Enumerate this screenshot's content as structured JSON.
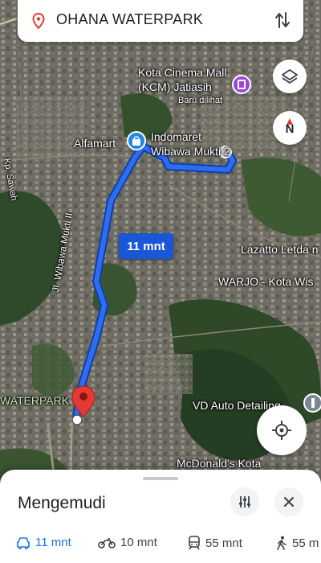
{
  "search": {
    "destination": "OHANA WATERPARK"
  },
  "map": {
    "labels": {
      "kcm_line1": "Kota Cinema Mall",
      "kcm_line2": "(KCM) Jatiasih",
      "kcm_sub": "Baru dilihat",
      "alfamart": "Alfamart",
      "indomaret_line1": "Indomaret",
      "indomaret_line2": "Wibawa Mukti 2",
      "lazatto": "Lazatto Letda n",
      "warjo": "WARJO - Kota Wis",
      "road": "Jl. Wibawa Mukti II",
      "waterpark": "WATERPARK",
      "vd_auto": "VD Auto Detailing",
      "mcdonalds": "McDonald's Kota",
      "kp_sawah": "Kp. Sawah"
    },
    "eta_badge": "11 mnt",
    "compass_letter": "N"
  },
  "colors": {
    "route": "#2f6df0",
    "accent": "#1a73e8",
    "pin": "#e53935"
  },
  "sheet": {
    "title": "Mengemudi",
    "modes": [
      {
        "icon": "car-icon",
        "label": "11 mnt",
        "active": true
      },
      {
        "icon": "motorbike-icon",
        "label": "10 mnt",
        "active": false
      },
      {
        "icon": "transit-icon",
        "label": "55 mnt",
        "active": false
      },
      {
        "icon": "walk-icon",
        "label": "55 m",
        "active": false
      }
    ]
  }
}
